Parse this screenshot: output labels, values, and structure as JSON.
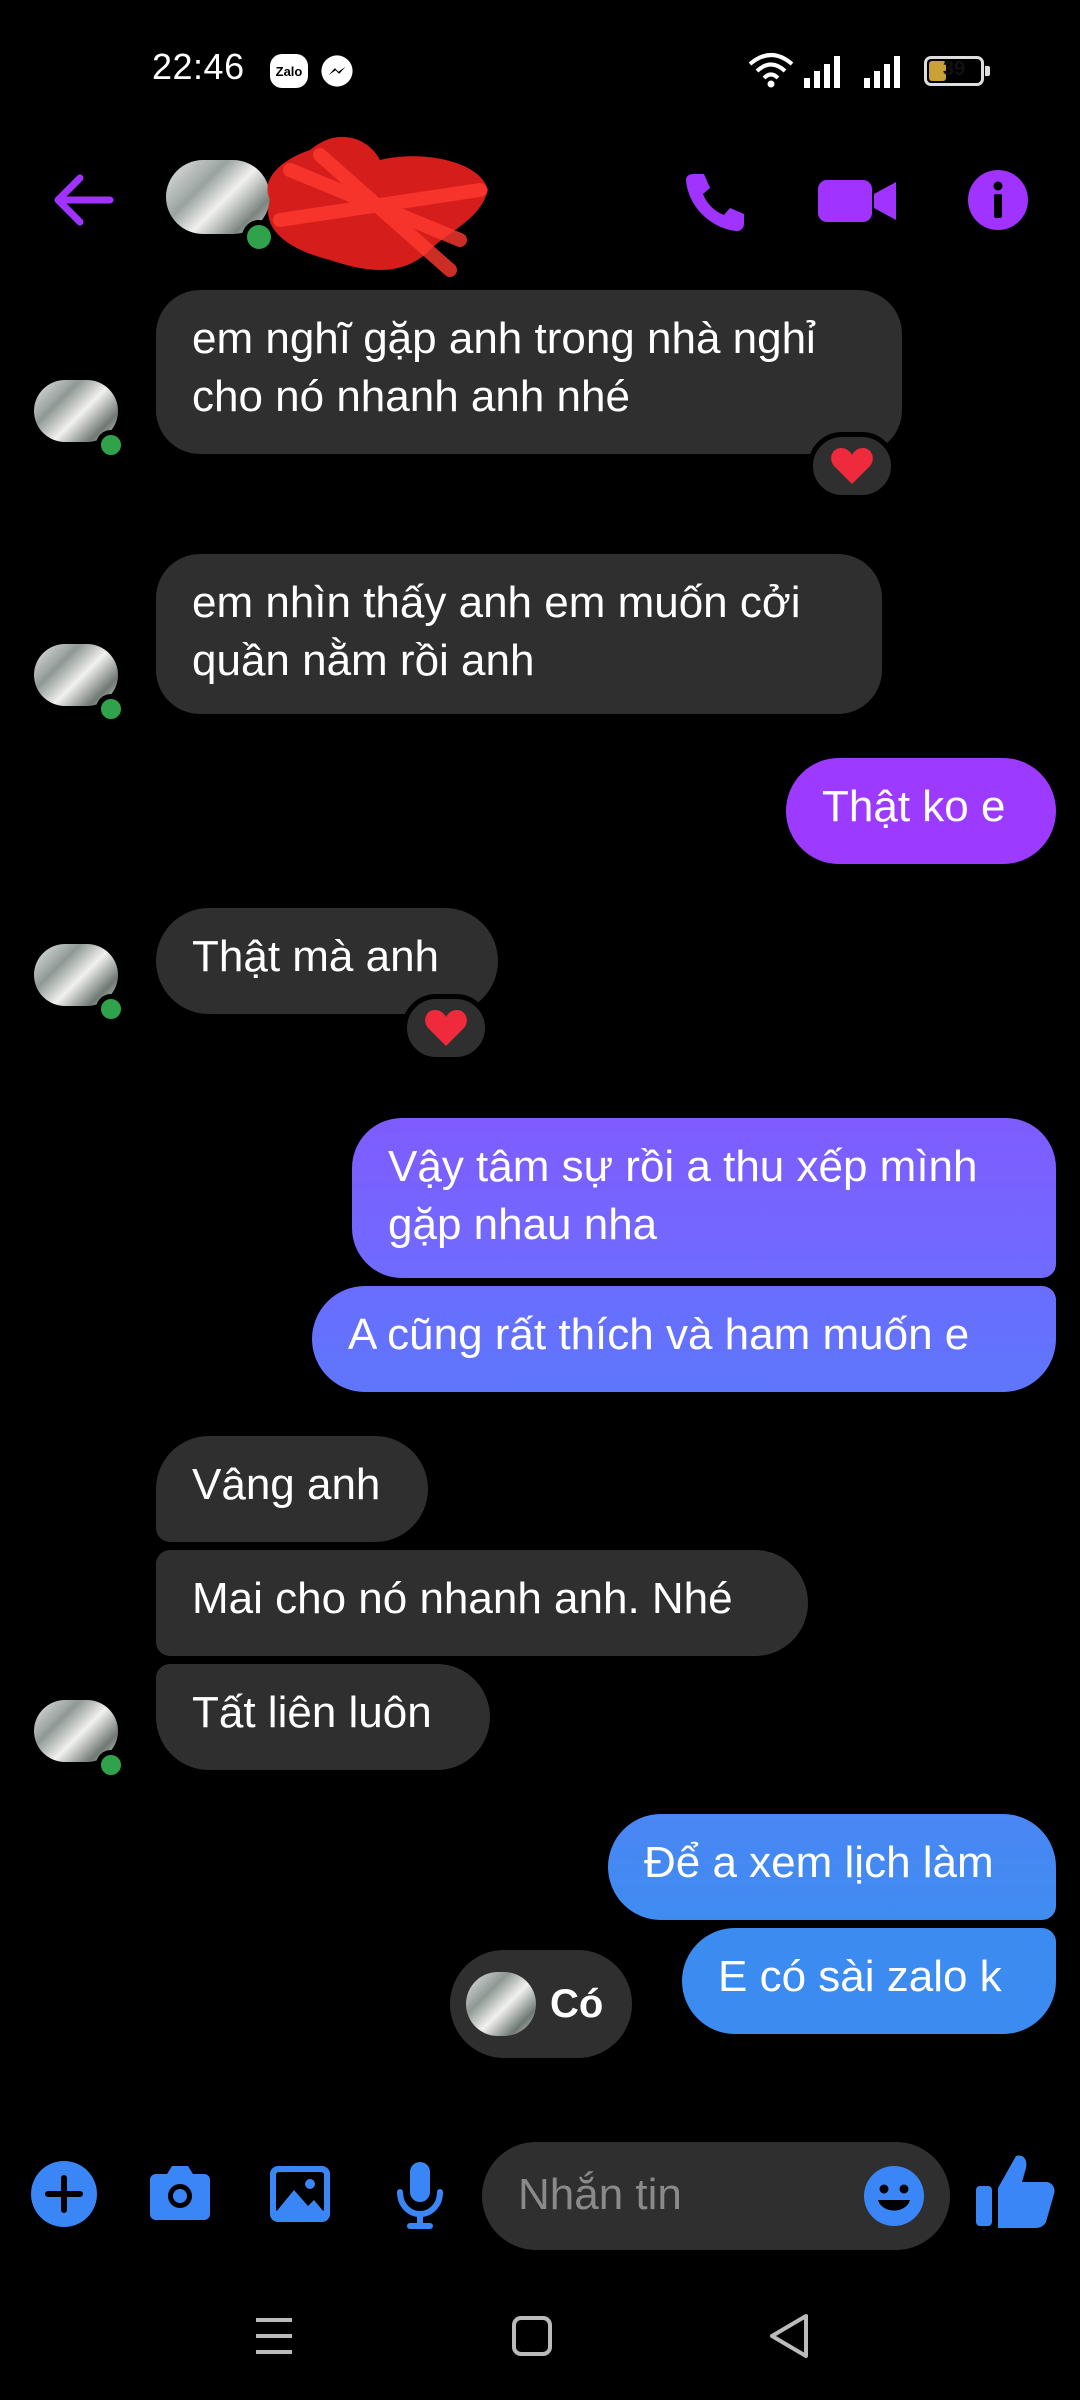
{
  "status_bar": {
    "time": "22:46",
    "zalo_label": "Zalo",
    "battery_level": "39",
    "icons": [
      "zalo-icon",
      "messenger-icon",
      "wifi-icon",
      "signal-icon",
      "signal-icon",
      "battery-icon"
    ]
  },
  "header": {
    "icons": [
      "back-arrow-icon",
      "phone-icon",
      "video-camera-icon",
      "info-icon"
    ],
    "accent_color": "#a033ff",
    "online": true
  },
  "messages": [
    {
      "from": "them",
      "lines": [
        "em nghĩ gặp anh trong nhà nghỉ",
        "cho nó nhanh anh nhé"
      ],
      "reaction": "❤️"
    },
    {
      "from": "them",
      "lines": [
        "em nhìn thấy anh em muốn cởi",
        "quần nằm rồi anh"
      ]
    },
    {
      "from": "me",
      "lines": [
        "Thật ko e"
      ]
    },
    {
      "from": "them",
      "lines": [
        "Thật mà anh"
      ],
      "reaction": "❤️"
    },
    {
      "from": "me",
      "lines": [
        "Vậy tâm sự rồi a thu xếp mình",
        "gặp nhau nha"
      ]
    },
    {
      "from": "me",
      "lines": [
        "A cũng rất thích và ham muốn e"
      ]
    },
    {
      "from": "them",
      "lines": [
        "Vâng anh"
      ]
    },
    {
      "from": "them",
      "lines": [
        "Mai cho nó nhanh anh. Nhé"
      ]
    },
    {
      "from": "them",
      "lines": [
        "Tất liên luôn"
      ]
    },
    {
      "from": "me",
      "lines": [
        "Để a xem lịch làm"
      ]
    },
    {
      "from": "me",
      "lines": [
        "E có sài zalo k"
      ]
    }
  ],
  "typing_preview": {
    "text": "Có"
  },
  "composer": {
    "placeholder": "Nhắn tin",
    "tools": [
      "plus-icon",
      "camera-icon",
      "image-icon",
      "microphone-icon"
    ],
    "emoji_icon": "emoji-icon",
    "like_icon": "thumbs-up-icon",
    "tool_color": "#3b86f6"
  },
  "nav_bar": {
    "icons": [
      "menu-icon",
      "home-square-icon",
      "back-triangle-icon"
    ]
  },
  "colors": {
    "incoming_bubble": "#2f2f2f",
    "outgoing_gradient_top": "#a033ff",
    "outgoing_gradient_mid": "#6d6cff",
    "outgoing_gradient_bottom": "#3b8bf0",
    "online_dot": "#31a24c"
  }
}
